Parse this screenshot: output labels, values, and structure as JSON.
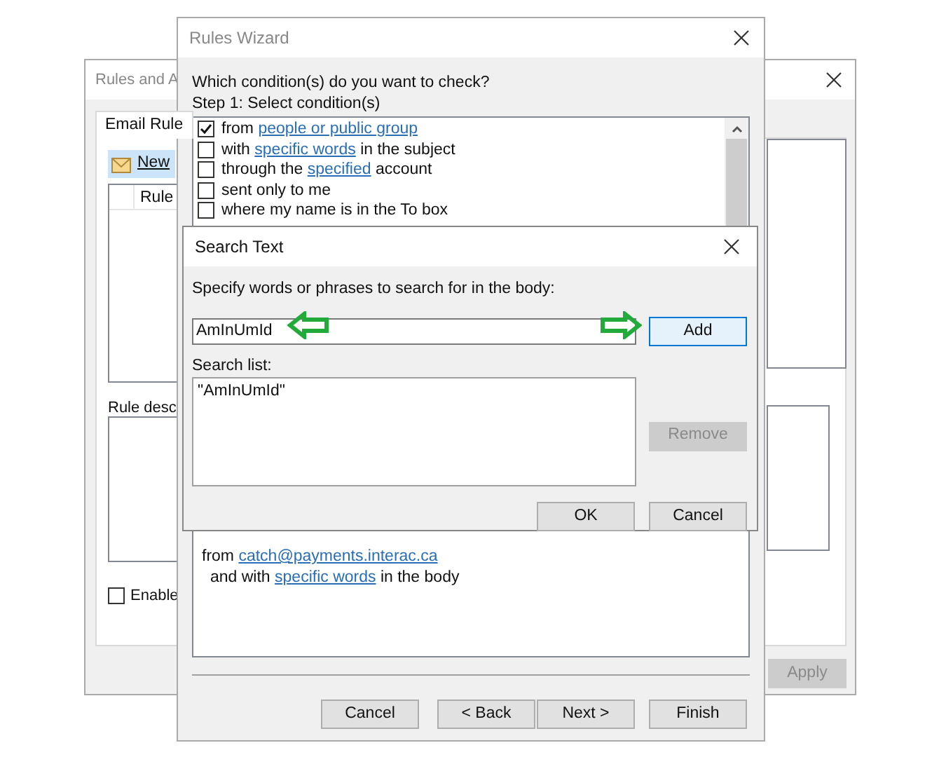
{
  "back_window": {
    "title": "Rules and A",
    "tab": {
      "label": "Email Rule",
      "selected": true
    },
    "new_rule_button": "New",
    "rule_column": "Rule",
    "rule_description_label": "Rule desc",
    "enable_checkbox": {
      "label": "Enable",
      "checked": false
    },
    "apply_button": {
      "label": "Apply",
      "disabled": true
    }
  },
  "wizard": {
    "title": "Rules Wizard",
    "question": "Which condition(s) do you want to check?",
    "step_label": "Step 1: Select condition(s)",
    "conditions": [
      {
        "checked": true,
        "segments": [
          {
            "kind": "text",
            "text": "from "
          },
          {
            "kind": "link",
            "text": "people or public group"
          }
        ]
      },
      {
        "checked": false,
        "segments": [
          {
            "kind": "text",
            "text": "with "
          },
          {
            "kind": "link",
            "text": "specific words"
          },
          {
            "kind": "text",
            "text": " in the subject"
          }
        ]
      },
      {
        "checked": false,
        "segments": [
          {
            "kind": "text",
            "text": "through the "
          },
          {
            "kind": "link",
            "text": "specified"
          },
          {
            "kind": "text",
            "text": " account"
          }
        ]
      },
      {
        "checked": false,
        "segments": [
          {
            "kind": "text",
            "text": "sent only to me"
          }
        ]
      },
      {
        "checked": false,
        "segments": [
          {
            "kind": "text",
            "text": "where my name is in the To box"
          }
        ]
      }
    ],
    "description": [
      {
        "indented": false,
        "segments": [
          {
            "kind": "text",
            "text": "from "
          },
          {
            "kind": "link",
            "text": "catch@payments.interac.ca"
          }
        ]
      },
      {
        "indented": true,
        "segments": [
          {
            "kind": "text",
            "text": "and with "
          },
          {
            "kind": "link",
            "text": "specific words"
          },
          {
            "kind": "text",
            "text": " in the body"
          }
        ]
      }
    ],
    "buttons": [
      {
        "label": "Cancel"
      },
      {
        "label": "< Back"
      },
      {
        "label": "Next >"
      },
      {
        "label": "Finish"
      }
    ]
  },
  "search_dialog": {
    "title": "Search Text",
    "prompt": "Specify words or phrases to search for in the body:",
    "input_value": "AmInUmId",
    "add_button": {
      "label": "Add",
      "default": true
    },
    "list_label": "Search list:",
    "search_list": [
      "\"AmInUmId\""
    ],
    "remove_button": {
      "label": "Remove",
      "disabled": true
    },
    "ok_button": "OK",
    "cancel_button": "Cancel"
  }
}
